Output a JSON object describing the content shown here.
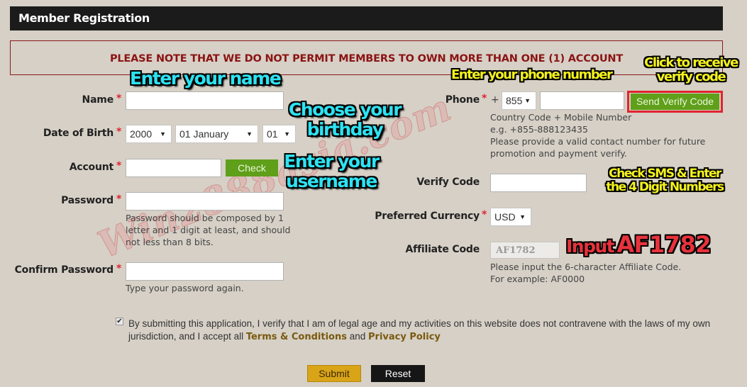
{
  "header": {
    "title": "Member Registration"
  },
  "notice": "PLEASE NOTE THAT WE DO NOT PERMIT MEMBERS TO OWN MORE THAN ONE (1) ACCOUNT",
  "required_mark": "*",
  "left_form": {
    "name": {
      "label": "Name",
      "value": ""
    },
    "dob": {
      "label": "Date of Birth",
      "year": "2000",
      "month": "01 January",
      "day": "01"
    },
    "account": {
      "label": "Account",
      "value": "",
      "check_button": "Check"
    },
    "password": {
      "label": "Password",
      "value": "",
      "help": "Password should be composed by 1 letter and 1 digit at least, and should not less than 8 bits."
    },
    "confirm_password": {
      "label": "Confirm Password",
      "value": "",
      "help": "Type your password again."
    }
  },
  "right_form": {
    "phone": {
      "label": "Phone",
      "plus": "+",
      "country_code": "855",
      "value": "",
      "send_button": "Send Verify Code",
      "help_lines": [
        "Country Code + Mobile Number",
        "e.g. +855-888123435",
        "Please provide a valid contact number for future",
        "promotion and payment verify."
      ]
    },
    "verify_code": {
      "label": "Verify Code",
      "value": ""
    },
    "currency": {
      "label": "Preferred Currency",
      "value": "USD"
    },
    "affiliate": {
      "label": "Affiliate Code",
      "value": "AF1782",
      "help_lines": [
        "Please input the 6-character Affiliate Code.",
        "For example: AF0000"
      ]
    }
  },
  "agreement": {
    "checked": true,
    "text_before": "By submitting this application, I verify that I am of legal age and my activities on this website does not contravene with the laws of my own jurisdiction, and I accept all ",
    "terms_link": "Terms & Conditions",
    "and": " and ",
    "privacy_link": "Privacy Policy"
  },
  "buttons": {
    "submit": "Submit",
    "reset": "Reset"
  },
  "annotations": {
    "enter_name": "Enter your name",
    "choose_birthday_1": "Choose your",
    "choose_birthday_2": "birthday",
    "enter_username_1": "Enter your",
    "enter_username_2": "username",
    "enter_phone": "Enter your phone number",
    "click_receive_1": "Click to receive",
    "click_receive_2": "verify code",
    "check_sms_1": "Check SMS & Enter",
    "check_sms_2": "the 4 Digit Numbers",
    "input_prefix": "Input",
    "input_code": "AF1782"
  },
  "watermark": "Win2888asia.com",
  "icons": {
    "dropdown": "▼",
    "check": "✔"
  }
}
